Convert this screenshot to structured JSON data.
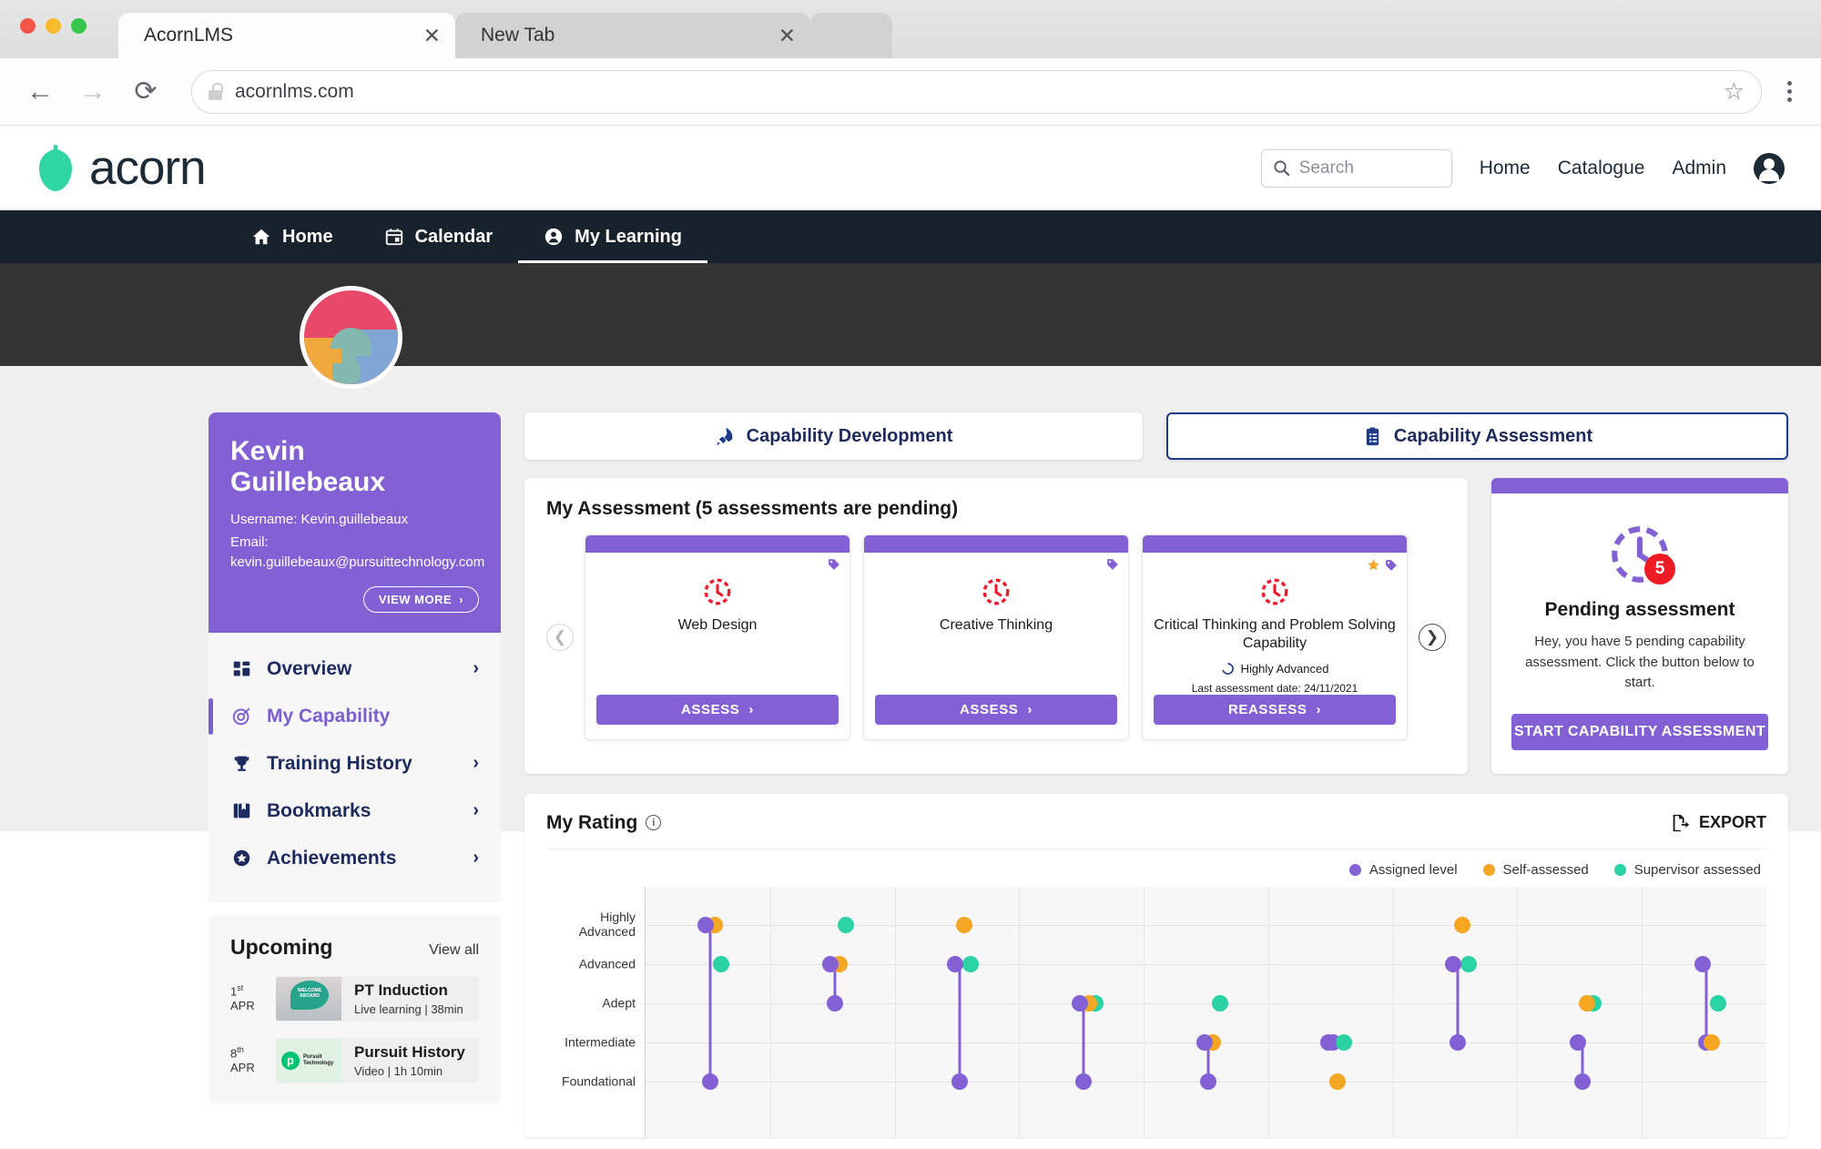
{
  "browser": {
    "tabs": [
      {
        "title": "AcornLMS",
        "close": "✕",
        "active": true
      },
      {
        "title": "New Tab",
        "close": "✕",
        "active": false
      }
    ],
    "back_icon": "←",
    "forward_icon": "→",
    "reload_icon": "⟳",
    "url": "acornlms.com",
    "star_icon": "☆",
    "lock_icon": "lock-icon",
    "menu_icon": "kebab-menu-icon"
  },
  "header": {
    "brand": "acorn",
    "search_placeholder": "Search",
    "nav": [
      "Home",
      "Catalogue",
      "Admin"
    ],
    "account_icon": "account-circle-icon"
  },
  "darknav": [
    {
      "label": "Home",
      "icon": "home-icon",
      "active": false
    },
    {
      "label": "Calendar",
      "icon": "calendar-icon",
      "active": false
    },
    {
      "label": "My Learning",
      "icon": "person-icon",
      "active": true
    }
  ],
  "profile": {
    "name_line1": "Kevin",
    "name_line2": "Guillebeaux",
    "username": "Username: Kevin.guillebeaux",
    "email": "Email: kevin.guillebeaux@pursuittechnology.com",
    "view_more": "VIEW MORE",
    "view_more_chevron": "›"
  },
  "sidebar": {
    "items": [
      {
        "label": "Overview",
        "icon": "dashboard-icon",
        "chevron": "›",
        "active": false
      },
      {
        "label": "My Capability",
        "icon": "target-icon",
        "chevron": "",
        "active": true
      },
      {
        "label": "Training History",
        "icon": "trophy-icon",
        "chevron": "›",
        "active": false
      },
      {
        "label": "Bookmarks",
        "icon": "bookmark-icon",
        "chevron": "›",
        "active": false
      },
      {
        "label": "Achievements",
        "icon": "star-badge-icon",
        "chevron": "›",
        "active": false
      }
    ]
  },
  "upcoming": {
    "title": "Upcoming",
    "view_all": "View all",
    "items": [
      {
        "day": "1",
        "suffix": "st",
        "month": "APR",
        "name": "PT Induction",
        "meta": "Live learning   |   38min",
        "thumb_text": "WELCOME ABOARD"
      },
      {
        "day": "8",
        "suffix": "th",
        "month": "APR",
        "name": "Pursuit History",
        "meta": "Video   |   1h 10min",
        "thumb_text": "Pursuit Technology"
      }
    ]
  },
  "tabs": [
    {
      "label": "Capability Development",
      "icon": "rocket-icon",
      "active": false
    },
    {
      "label": "Capability Assessment",
      "icon": "clipboard-icon",
      "active": true
    }
  ],
  "assessment": {
    "title": "My Assessment (5 assessments are pending)",
    "prev_icon": "chevron-left-icon",
    "next_icon": "chevron-right-icon",
    "cards": [
      {
        "name": "Web Design",
        "button": "ASSESS",
        "button_chevron": "›",
        "level": "",
        "last_date": "",
        "starred": false,
        "tag": true
      },
      {
        "name": "Creative Thinking",
        "button": "ASSESS",
        "button_chevron": "›",
        "level": "",
        "last_date": "",
        "starred": false,
        "tag": true
      },
      {
        "name": "Critical Thinking and Problem Solving Capability",
        "button": "REASSESS",
        "button_chevron": "›",
        "level": "Highly Advanced",
        "last_date": "Last assessment date: 24/11/2021",
        "starred": true,
        "tag": true
      }
    ]
  },
  "pending": {
    "count": "5",
    "title": "Pending assessment",
    "text": "Hey, you have 5 pending capability assessment. Click the button below to start.",
    "button": "START CAPABILITY ASSESSMENT"
  },
  "rating": {
    "title": "My Rating",
    "info_icon": "info-icon",
    "export_label": "EXPORT",
    "export_icon": "export-icon"
  },
  "colors": {
    "purple": "#8361d4",
    "orange": "#f5a623",
    "teal": "#2bd2a4",
    "navy": "#1d2b5e",
    "brand_green": "#2fd6a3",
    "red": "#ef1b2d"
  },
  "chart_data": {
    "type": "scatter",
    "title": "My Rating",
    "xlabel": "",
    "ylabel": "",
    "categories": [
      "Highly Advanced",
      "Advanced",
      "Adept",
      "Intermediate",
      "Foundational"
    ],
    "level_order": [
      "Foundational",
      "Intermediate",
      "Adept",
      "Advanced",
      "Highly Advanced"
    ],
    "legend": [
      {
        "name": "Assigned level",
        "color": "#8361d4"
      },
      {
        "name": "Self-assessed",
        "color": "#f5a623"
      },
      {
        "name": "Supervisor assessed",
        "color": "#2bd2a4"
      }
    ],
    "legend_position": "top-right",
    "grid": true,
    "series": [
      {
        "name": "Assigned level",
        "color": "#8361d4",
        "values": [
          "Highly Advanced",
          "Advanced",
          "Advanced",
          "Adept",
          "Intermediate",
          "Intermediate",
          "Advanced",
          "Intermediate",
          "Advanced"
        ]
      },
      {
        "name": "Self-assessed",
        "color": "#f5a623",
        "values": [
          "Highly Advanced",
          "Advanced",
          "Highly Advanced",
          "Adept",
          "Intermediate",
          "Foundational",
          "Highly Advanced",
          "Adept",
          "Intermediate"
        ]
      },
      {
        "name": "Supervisor assessed",
        "color": "#2bd2a4",
        "values": [
          "Advanced",
          "Highly Advanced",
          "Advanced",
          "Adept",
          "Adept",
          "Intermediate",
          "Advanced",
          "Adept",
          "Adept"
        ]
      }
    ],
    "assigned_ranges": [
      {
        "index": 0,
        "from": "Foundational",
        "to": "Highly Advanced"
      },
      {
        "index": 1,
        "from": "Adept",
        "to": "Advanced"
      },
      {
        "index": 2,
        "from": "Foundational",
        "to": "Advanced"
      },
      {
        "index": 3,
        "from": "Foundational",
        "to": "Adept"
      },
      {
        "index": 4,
        "from": "Foundational",
        "to": "Intermediate"
      },
      {
        "index": 5,
        "from": "Intermediate",
        "to": "Intermediate"
      },
      {
        "index": 6,
        "from": "Intermediate",
        "to": "Advanced"
      },
      {
        "index": 7,
        "from": "Foundational",
        "to": "Intermediate"
      },
      {
        "index": 8,
        "from": "Intermediate",
        "to": "Advanced"
      }
    ]
  }
}
